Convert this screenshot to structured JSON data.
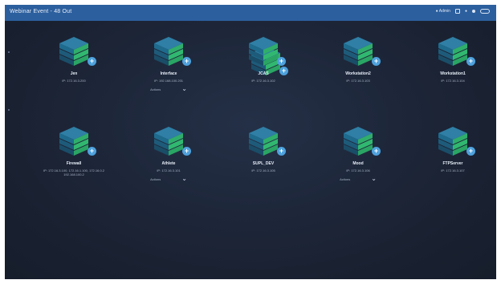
{
  "window": {
    "title": "Webinar Event - 48 Out"
  },
  "toolbar": {
    "status_text": "● Admin",
    "user_text": "● ",
    "toggle_label": ""
  },
  "colors": {
    "accent": "#2c5f9e",
    "background": "#1c2536",
    "node_green": "#2fae6b",
    "node_navy": "#1f3a5c",
    "badge": "#4ea1dc"
  },
  "center_node": {
    "icon": "server-stack-icon",
    "badge_icon": "add-icon"
  },
  "nodes": [
    {
      "name": "Jen",
      "ip": "IP: 172.16.3.200",
      "has_control": false
    },
    {
      "name": "Interface",
      "ip": "IP: 192.168.100.201",
      "has_control": true,
      "control_label": "Actions"
    },
    {
      "name": "JCAS",
      "ip": "IP: 172.16.3.102",
      "has_control": false
    },
    {
      "name": "Workstation2",
      "ip": "IP: 172.16.3.103",
      "has_control": false
    },
    {
      "name": "Workstation1",
      "ip": "IP: 172.16.3.104",
      "has_control": false
    },
    {
      "name": "Firewall",
      "ip": "IP: 172.16.3.100, 172.16.1.100, 172.16.0.2",
      "ip2": "192.168.100.2",
      "has_control": false
    },
    {
      "name": "Athlete",
      "ip": "IP: 172.16.3.101",
      "has_control": true,
      "control_label": "Actions"
    },
    {
      "name": "SUPL_DEV",
      "ip": "IP: 172.16.3.105",
      "has_control": false
    },
    {
      "name": "Mood",
      "ip": "IP: 172.16.3.106",
      "has_control": true,
      "control_label": "Actions"
    },
    {
      "name": "FTPServer",
      "ip": "IP: 172.16.3.107",
      "has_control": false
    }
  ]
}
